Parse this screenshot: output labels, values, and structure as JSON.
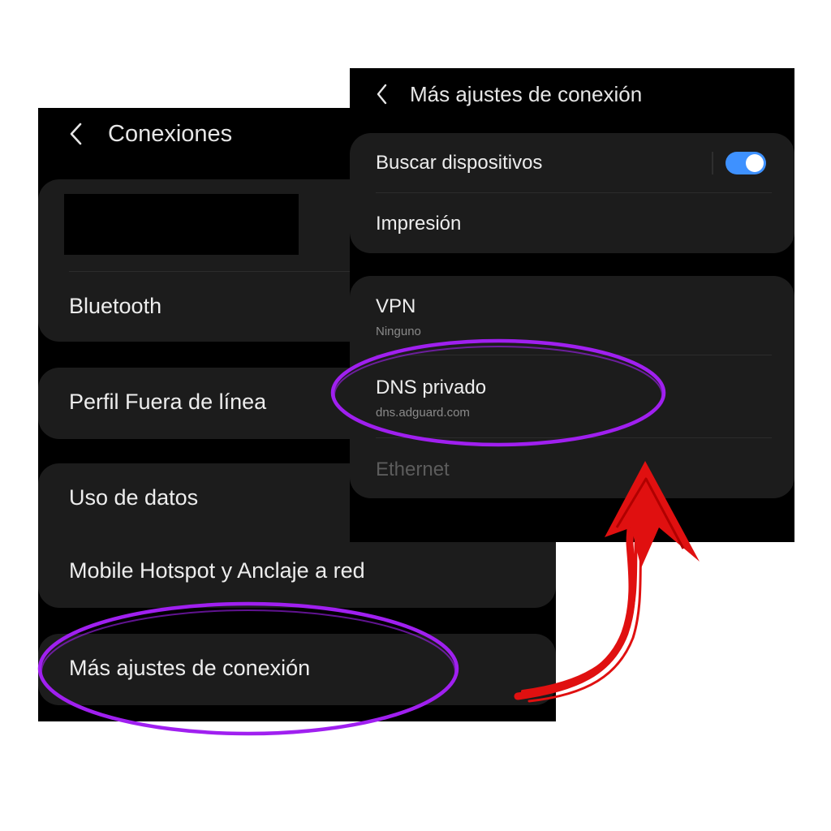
{
  "left_screen": {
    "header": {
      "title": "Conexiones"
    },
    "items": {
      "bluetooth": "Bluetooth",
      "offline_profile": "Perfil Fuera de línea",
      "data_usage": "Uso de datos",
      "hotspot": "Mobile Hotspot y Anclaje a red",
      "more_settings": "Más ajustes de conexión"
    }
  },
  "right_screen": {
    "header": {
      "title": "Más ajustes de conexión"
    },
    "items": {
      "search_devices": {
        "label": "Buscar dispositivos",
        "toggle_on": true
      },
      "printing": "Impresión",
      "vpn": {
        "label": "VPN",
        "value": "Ninguno"
      },
      "private_dns": {
        "label": "DNS privado",
        "value": "dns.adguard.com"
      },
      "ethernet": "Ethernet"
    }
  },
  "annotations": {
    "highlight_color": "#a020f0",
    "arrow_color": "#e01010"
  },
  "icons": {
    "back": "chevron-left-icon"
  }
}
